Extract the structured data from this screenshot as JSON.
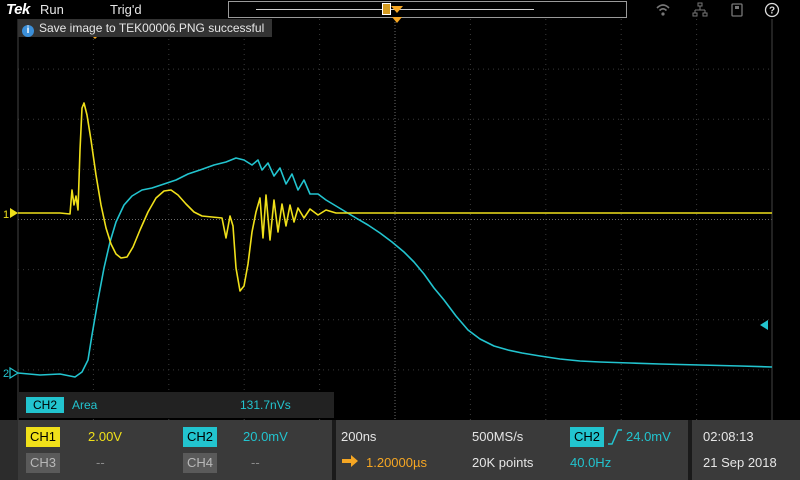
{
  "topbar": {
    "brand": "Tek",
    "status": "Run",
    "trigger_state": "Trig'd"
  },
  "message": {
    "text": "Save image to TEK00006.PNG successful"
  },
  "markers": {
    "ch1": "1",
    "ch2": "2"
  },
  "measurement": {
    "channel": "CH2",
    "name": "Area",
    "value": "131.7nVs"
  },
  "channels": {
    "ch1": {
      "label": "CH1",
      "scale": "2.00V"
    },
    "ch2": {
      "label": "CH2",
      "scale": "20.0mV"
    },
    "ch3": {
      "label": "CH3",
      "scale": "--"
    },
    "ch4": {
      "label": "CH4",
      "scale": "--"
    }
  },
  "horizontal": {
    "scale": "200ns",
    "delay": "1.20000µs"
  },
  "acquisition": {
    "rate": "500MS/s",
    "points": "20K points"
  },
  "trigger": {
    "source": "CH2",
    "level": "24.0mV",
    "frequency": "40.0Hz"
  },
  "clock": {
    "time": "02:08:13",
    "date": "21 Sep 2018"
  },
  "colors": {
    "ch1": "#f0e01a",
    "ch2": "#22c4cf",
    "trigger": "#f5a623"
  },
  "icons": [
    "wifi-icon",
    "network-icon",
    "usb-icon",
    "help-icon"
  ]
}
